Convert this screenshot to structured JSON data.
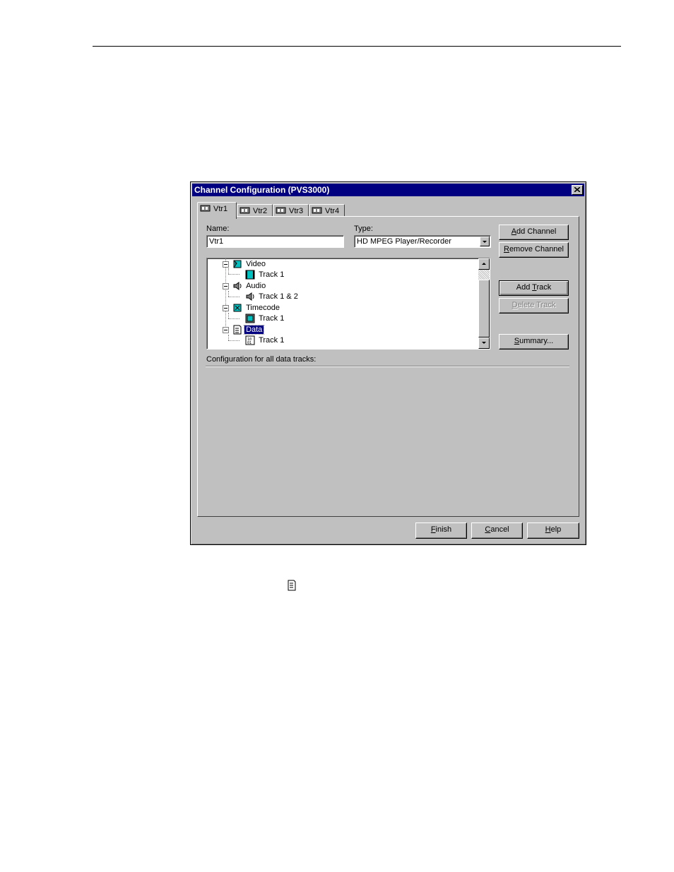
{
  "dialog": {
    "title": "Channel Configuration (PVS3000)",
    "tabs": [
      {
        "label": "Vtr1",
        "active": true
      },
      {
        "label": "Vtr2",
        "active": false
      },
      {
        "label": "Vtr3",
        "active": false
      },
      {
        "label": "Vtr4",
        "active": false
      }
    ],
    "name_label": "Name:",
    "name_value": "Vtr1",
    "type_label": "Type:",
    "type_value": "HD MPEG Player/Recorder",
    "tree": [
      {
        "label": "Video",
        "level": 0,
        "icon": "video-icon",
        "expanded": true
      },
      {
        "label": "Track 1",
        "level": 1,
        "icon": "film-icon"
      },
      {
        "label": "Audio",
        "level": 0,
        "icon": "speaker-icon",
        "expanded": true
      },
      {
        "label": "Track 1 & 2",
        "level": 1,
        "icon": "speaker-icon"
      },
      {
        "label": "Timecode",
        "level": 0,
        "icon": "timecode-icon",
        "expanded": true
      },
      {
        "label": "Track 1",
        "level": 1,
        "icon": "timecode-track-icon"
      },
      {
        "label": "Data",
        "level": 0,
        "icon": "data-icon",
        "expanded": true,
        "selected": true
      },
      {
        "label": "Track 1",
        "level": 1,
        "icon": "data-track-icon"
      }
    ],
    "buttons": {
      "add_channel": {
        "pre": "",
        "key": "A",
        "post": "dd Channel"
      },
      "remove_channel": {
        "pre": "",
        "key": "R",
        "post": "emove Channel"
      },
      "add_track": {
        "pre": "Add ",
        "key": "T",
        "post": "rack"
      },
      "delete_track": {
        "pre": "",
        "key": "D",
        "post": "elete Track"
      },
      "summary": {
        "pre": "",
        "key": "S",
        "post": "ummary..."
      },
      "finish": {
        "pre": "",
        "key": "F",
        "post": "inish"
      },
      "cancel": {
        "pre": "",
        "key": "C",
        "post": "ancel"
      },
      "help": {
        "pre": "",
        "key": "H",
        "post": "elp"
      }
    },
    "config_label": "Configuration for all data tracks:"
  },
  "colors": {
    "face": "#c0c0c0",
    "titlebar": "#000080",
    "selection": "#000080"
  }
}
